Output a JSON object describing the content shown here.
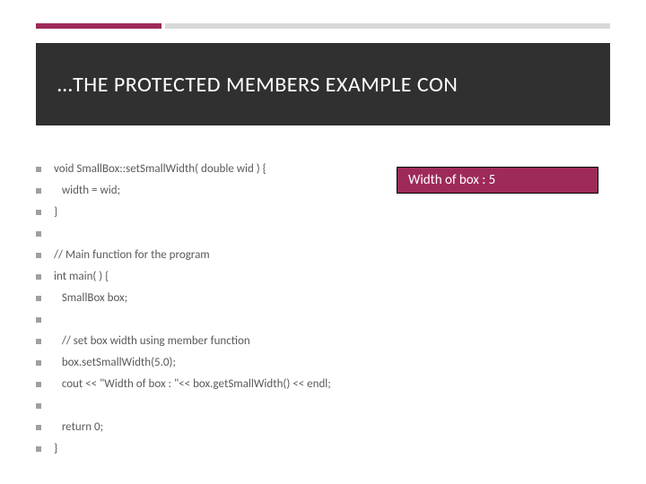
{
  "title": "…THE PROTECTED MEMBERS EXAMPLE CON",
  "output": "Width of box : 5",
  "code_lines": [
    "void SmallBox::setSmallWidth( double wid ) {",
    "   width = wid;",
    "}",
    "",
    "// Main function for the program",
    "int main( ) {",
    "   SmallBox box;",
    "",
    "   // set box width using member function",
    "   box.setSmallWidth(5.0);",
    "   cout << \"Width of box : \"<< box.getSmallWidth() << endl;",
    "",
    "   return 0;",
    "}"
  ]
}
